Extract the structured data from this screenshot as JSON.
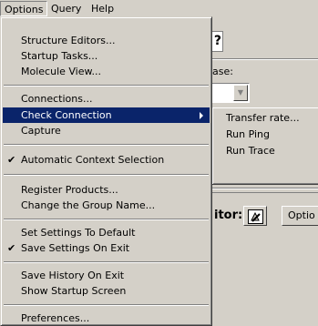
{
  "menubar": {
    "items": [
      {
        "label": "Options",
        "open": true
      },
      {
        "label": "Query",
        "open": false
      },
      {
        "label": "Help",
        "open": false
      }
    ]
  },
  "background": {
    "help_char": "?",
    "base_label": "ase:",
    "editor_label": "itor:",
    "options_button": "Optio"
  },
  "options_menu": {
    "items": [
      {
        "label": "Structure Editors...",
        "checked": false
      },
      {
        "label": "Startup Tasks...",
        "checked": false
      },
      {
        "label": "Molecule View...",
        "checked": false
      },
      {
        "label": "Connections...",
        "checked": false
      },
      {
        "label": "Check Connection",
        "checked": false,
        "highlighted": true,
        "submenu": true
      },
      {
        "label": "Capture",
        "checked": false
      },
      {
        "label": "Automatic Context Selection",
        "checked": true
      },
      {
        "label": "Register Products...",
        "checked": false
      },
      {
        "label": "Change the Group Name...",
        "checked": false
      },
      {
        "label": "Set Settings To Default",
        "checked": false
      },
      {
        "label": "Save Settings On Exit",
        "checked": true
      },
      {
        "label": "Save History On Exit",
        "checked": false
      },
      {
        "label": "Show Startup Screen",
        "checked": false
      },
      {
        "label": "Preferences...",
        "checked": false
      }
    ],
    "check_glyph": "✔"
  },
  "check_connection_submenu": {
    "items": [
      {
        "label": "Transfer rate..."
      },
      {
        "label": "Run Ping"
      },
      {
        "label": "Run Trace"
      }
    ]
  },
  "colors": {
    "face": "#d4d0c8",
    "highlight": "#0a246a"
  }
}
